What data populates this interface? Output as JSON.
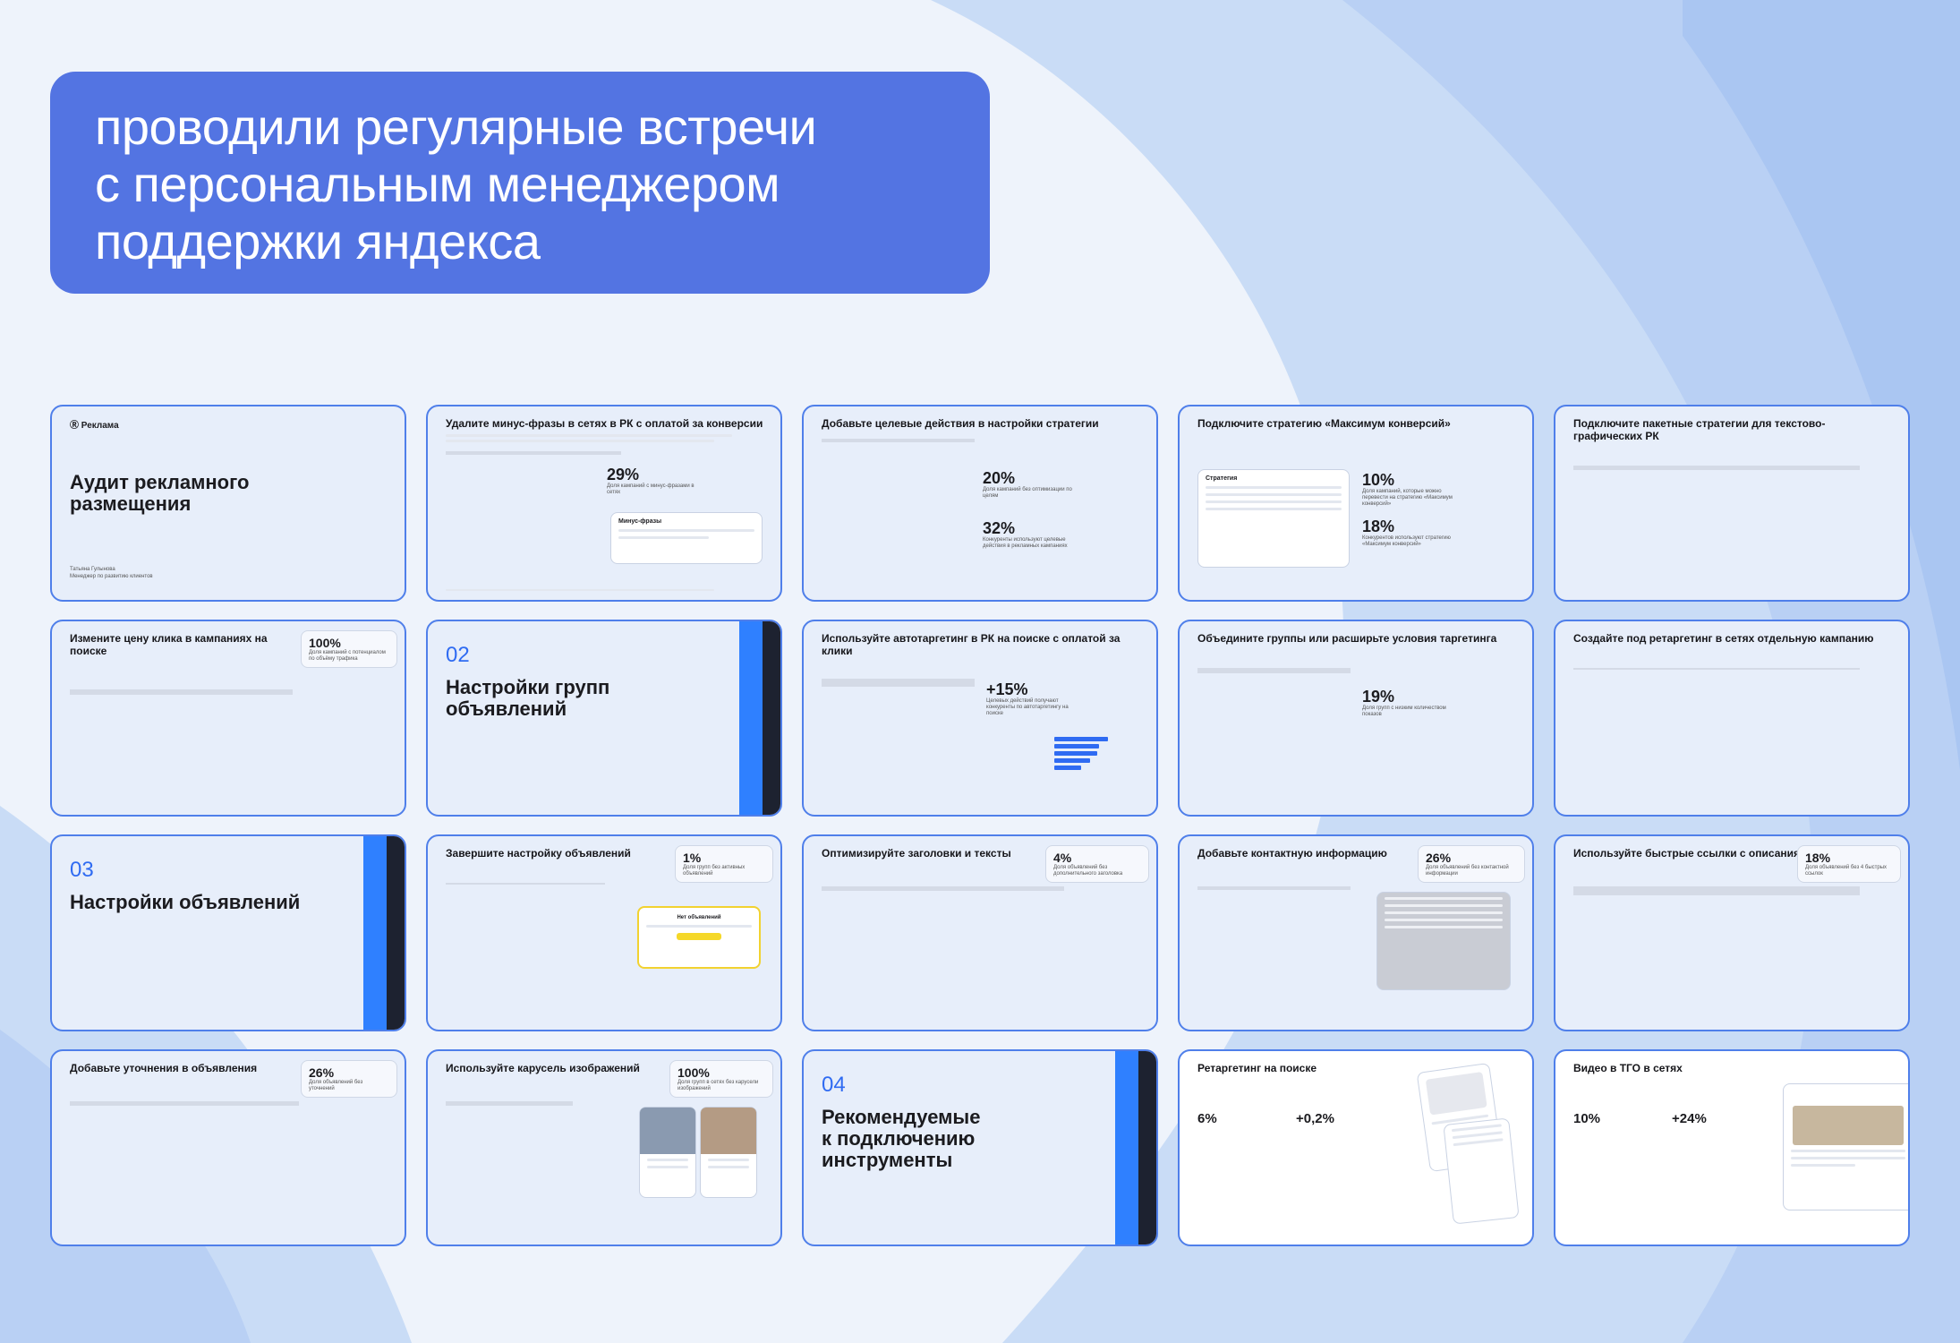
{
  "hero": {
    "lines": [
      "проводили регулярные встречи",
      "с персональным менеджером",
      "поддержки яндекса"
    ]
  },
  "colors": {
    "accent": "#5374e2",
    "slide_bg": "#e7eefa",
    "slide_border": "#4f7fea",
    "stripe_blue": "#2f80ff",
    "stripe_dark": "#1d2230"
  },
  "slides": {
    "s1": {
      "logo": "Реклама",
      "title_1": "Аудит рекламного",
      "title_2": "размещения",
      "name": "Татьяна Гулынова",
      "role": "Менеджер по развитию клиентов"
    },
    "s2": {
      "title": "Удалите минус-фразы в сетях в РК с оплатой за конверсии",
      "stat": "29%",
      "stat_label": "Доля кампаний с минус-фразами в сетях",
      "card": "Минус-фразы"
    },
    "s3": {
      "title": "Добавьте целевые действия в настройки стратегии",
      "stat1": "20%",
      "stat1_label": "Доля кампаний без оптимизации по целям",
      "stat2": "32%",
      "stat2_label": "Конкуренты используют целевые действия в рекламных кампаниях"
    },
    "s4": {
      "title": "Подключите стратегию «Максимум конверсий»",
      "card": "Стратегия",
      "stat1": "10%",
      "stat1_label": "Доля кампаний, которые можно перевести на стратегию «Максимум конверсий»",
      "stat2": "18%",
      "stat2_label": "Конкурентов используют стратегию «Максимум конверсий»"
    },
    "s5": {
      "title": "Подключите пакетные стратегии для текстово-графических РК"
    },
    "s6": {
      "title": "Измените цену клика в кампаниях на поиске",
      "stat": "100%",
      "stat_label": "Доля кампаний с потенциалом по объёму трафика"
    },
    "s7": {
      "num": "02",
      "title_1": "Настройки групп",
      "title_2": "объявлений"
    },
    "s8": {
      "title": "Используйте автотаргетинг в РК на поиске с оплатой за клики",
      "stat": "+15%",
      "stat_label": "Целевых действий получают конкуренты по автотаргетингу на поиске"
    },
    "s9": {
      "title": "Объедините группы или расширьте условия таргетинга",
      "stat": "19%",
      "stat_label": "Доля групп с низким количеством показов"
    },
    "s10": {
      "title": "Создайте под ретаргетинг в сетях отдельную кампанию"
    },
    "s11": {
      "num": "03",
      "title": "Настройки объявлений"
    },
    "s12": {
      "title": "Завершите настройку объявлений",
      "stat": "1%",
      "stat_label": "Доля групп без активных объявлений",
      "card": "Нет объявлений"
    },
    "s13": {
      "title": "Оптимизируйте заголовки и тексты",
      "stat": "4%",
      "stat_label": "Доля объявлений без дополнительного заголовка"
    },
    "s14": {
      "title": "Добавьте контактную информацию",
      "stat": "26%",
      "stat_label": "Доля объявлений без контактной информации"
    },
    "s15": {
      "title": "Используйте быстрые ссылки с описаниями",
      "stat": "18%",
      "stat_label": "Доля объявлений без 4 быстрых ссылок"
    },
    "s16": {
      "title": "Добавьте уточнения в объявления",
      "stat": "26%",
      "stat_label": "Доля объявлений без уточнений"
    },
    "s17": {
      "title": "Используйте карусель изображений",
      "stat": "100%",
      "stat_label": "Доля групп в сетях без карусели изображений"
    },
    "s18": {
      "num": "04",
      "title_1": "Рекомендуемые",
      "title_2": "к подключению",
      "title_3": "инструменты"
    },
    "s19": {
      "title": "Ретаргетинг на поиске",
      "stat1": "6%",
      "stat2": "+0,2%"
    },
    "s20": {
      "title": "Видео в ТГО в сетях",
      "stat1": "10%",
      "stat2": "+24%"
    }
  }
}
